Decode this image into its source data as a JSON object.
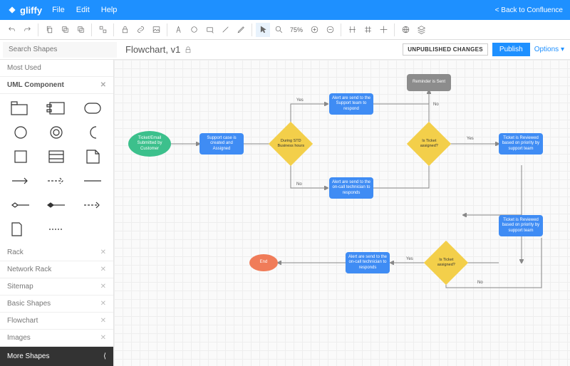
{
  "app": {
    "name": "gliffy"
  },
  "menu": {
    "file": "File",
    "edit": "Edit",
    "help": "Help",
    "back": "< Back to Confluence"
  },
  "toolbar": {
    "zoom": "75%"
  },
  "search": {
    "placeholder": "Search Shapes"
  },
  "document": {
    "title": "Flowchart, v1"
  },
  "status": {
    "unpublished": "UNPUBLISHED CHANGES",
    "publish": "Publish",
    "options": "Options"
  },
  "sidebar": {
    "most_used": "Most Used",
    "uml": "UML Component",
    "cats": {
      "rack": "Rack",
      "network": "Network Rack",
      "sitemap": "Sitemap",
      "basic": "Basic Shapes",
      "flowchart": "Flowchart",
      "images": "Images"
    },
    "more": "More Shapes"
  },
  "nodes": {
    "start": "Ticket/Email Submitted by Customer",
    "a": "Support case is created and Assigned",
    "d1": "During STD Business hours",
    "b1": "Alert are send to the Support team to respond",
    "b2": "Alert are send to the on-call technician to responds",
    "r": "Reminder is Sent",
    "d2": "Is Ticket assigned?",
    "c1": "Ticket is Reviewed based on priority by support team",
    "c2": "Ticket is Reviewed based on priority by support team",
    "d3": "Is Ticket assigned?",
    "b3": "Alert are send to the on-call technician to responds",
    "end": "End"
  },
  "labels": {
    "yes": "Yes",
    "no": "No"
  }
}
